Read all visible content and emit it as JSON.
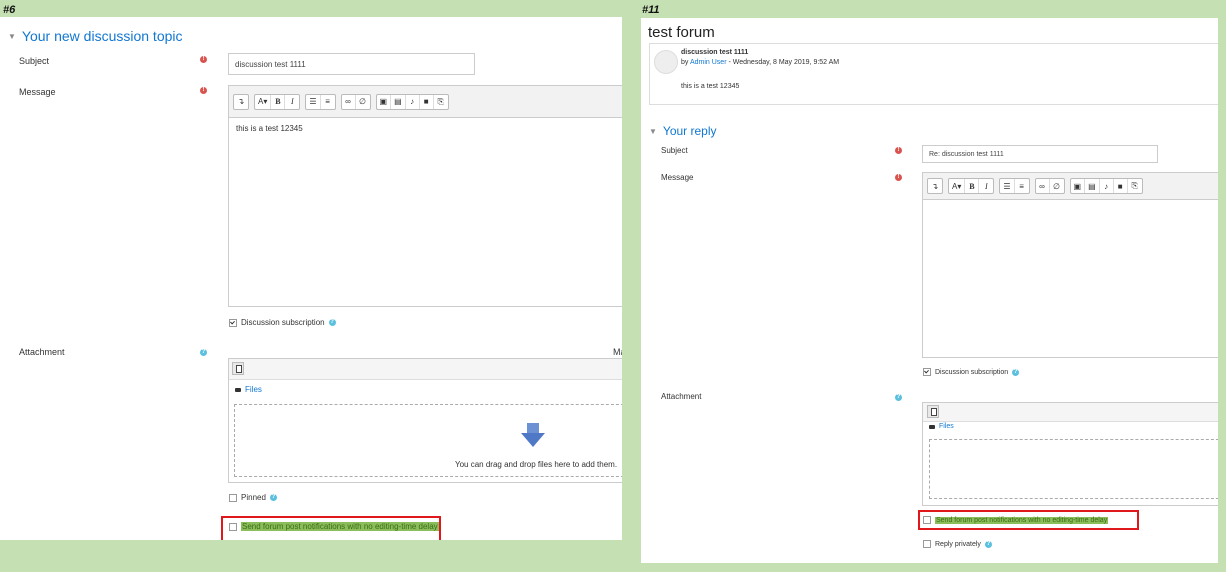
{
  "left": {
    "tag": "#6",
    "heading": "Your new discussion topic",
    "subject_label": "Subject",
    "subject_value": "discussion test 1111",
    "message_label": "Message",
    "message_text": "this is a test 12345",
    "discussion_subscription": "Discussion subscription",
    "attachment_label": "Attachment",
    "max_cut_text": "Ma",
    "files_label": "Files",
    "drop_text": "You can drag and drop files here to add them.",
    "pinned_label": "Pinned",
    "send_notifications": "Send forum post notifications with no editing-time delay"
  },
  "right": {
    "tag": "#11",
    "title": "test forum",
    "post": {
      "subject": "discussion test 1111",
      "by_prefix": "by",
      "author": "Admin User",
      "date": "- Wednesday, 8 May 2019, 9:52 AM",
      "body": "this is a test 12345"
    },
    "heading": "Your reply",
    "subject_label": "Subject",
    "subject_value": "Re: discussion test 1111",
    "message_label": "Message",
    "discussion_subscription": "Discussion subscription",
    "attachment_label": "Attachment",
    "files_label": "Files",
    "send_notifications": "Send forum post notifications with no editing-time delay",
    "reply_privately": "Reply privately"
  },
  "toolbar": {
    "collapse": "↴",
    "font": "A▾",
    "bold": "B",
    "italic": "I",
    "ul": "☰",
    "ol": "≡",
    "link": "∞",
    "unlink": "∅",
    "image": "▣",
    "media": "▤",
    "record_audio": "♪",
    "record_video": "■",
    "manage_files": "⎘"
  },
  "colors": {
    "background": "#c5e0b3",
    "link": "#1177d1",
    "required": "#d9534f",
    "help": "#5bc0de",
    "highlight": "#8bbd5a",
    "redbox": "#e0181c"
  }
}
